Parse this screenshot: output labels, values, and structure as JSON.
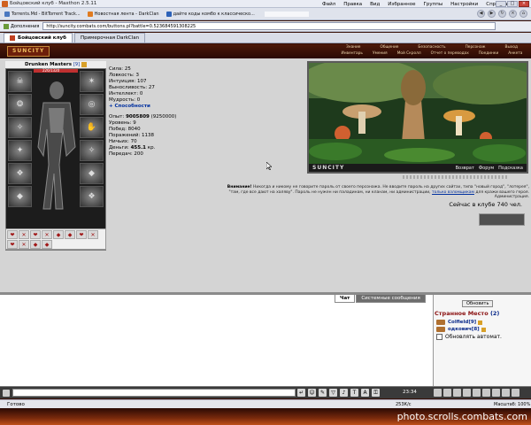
{
  "window": {
    "title": "Бойцовский клуб - Maxthon 2.5.11",
    "menu": [
      "Файл",
      "Правка",
      "Вид",
      "Избранное",
      "Группы",
      "Настройки",
      "Справка"
    ]
  },
  "browser_tabs": [
    {
      "label": "Torrents.Md - BitTorrent Track..."
    },
    {
      "label": "Новостная лента - DarkClan"
    },
    {
      "label": "дайте коды комбо к классическо..."
    }
  ],
  "address": {
    "addons_label": "Дополнения",
    "url": "http://suncity.combats.com/buttons.pl?battle=0.523684591308225"
  },
  "page_tabs": [
    {
      "label": "Бойцовский клуб"
    },
    {
      "label": "Примерочная DarkClan"
    }
  ],
  "game": {
    "logo": "SUNCITY",
    "nav_top": [
      "Знание",
      "Общение",
      "Безопасность",
      "Персонаж",
      "Выход"
    ],
    "nav_bottom": [
      "Инвентарь",
      "Умения",
      "Мой Скролл",
      "Отчет о переводах",
      "Поединки",
      "Анкета"
    ],
    "character": {
      "name": "Drunken Masters",
      "level": "[9]",
      "hp": "226/1320"
    },
    "stats": {
      "strength": "Сила: 25",
      "agility": "Ловкость: 3",
      "intuition": "Интуиция: 107",
      "endurance": "Выносливость: 27",
      "intellect": "Интеллект: 0",
      "wisdom": "Мудрость: 0",
      "abilities": "+ Способности"
    },
    "progress": {
      "exp_label": "Опыт:",
      "exp": "9005809",
      "exp_next": "(9250000)",
      "level": "Уровень: 9",
      "wins": "Побед: 8040",
      "losses": "Поражений: 1138",
      "draws": "Ничьих: 70",
      "money_label": "Деньги:",
      "money": "455.1",
      "money_unit": "кр.",
      "transfers": "Передач: 200"
    },
    "banner": {
      "brand": "SUNCITY",
      "links": [
        "Возврат",
        "Форум",
        "Подсказка"
      ]
    },
    "warning": {
      "bold": "Внимание!",
      "text1": " Никогда и никому не говорите пароль от своего персонажа. Не вводите пароль на других сайтах, типа \"новый город\", \"лотерея\",",
      "text2": "\"там, где все дают на халяву\". Пароль не нужен ни паладинам, ни кланам, ни администрации,",
      "link": "только взломщикам",
      "text3": " для кражи вашего героя.",
      "signature": "Администрация."
    },
    "online": "Сейчас в клубе 740 чел."
  },
  "chat": {
    "tabs": [
      "Чат",
      "Системные сообщения"
    ],
    "refresh_label": "Обновить",
    "location": "Странное Место",
    "count": "(2)",
    "users": [
      {
        "name": "Colfield",
        "level": "[9]"
      },
      {
        "name": "одкович",
        "level": "[8]"
      }
    ],
    "auto_refresh": "Обновлять автомат.",
    "clock": "23:34"
  },
  "status": {
    "ready": "Готово",
    "speed": "253К/с",
    "zoom": "Масштаб: 100%"
  },
  "watermark": "photo.scrolls.combats.com"
}
